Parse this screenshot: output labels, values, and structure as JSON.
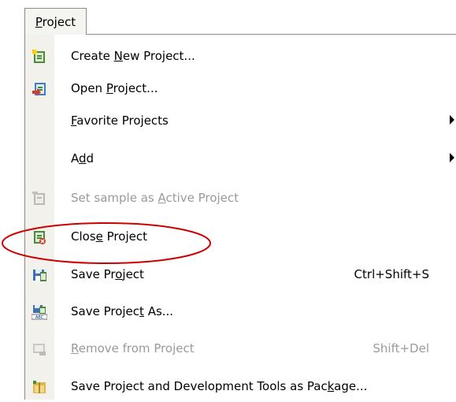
{
  "menu": {
    "title": "Project",
    "title_mnemonic_index": 0,
    "accent_color": "#cc0000",
    "items": [
      {
        "label_pre": "Create ",
        "label_mn": "N",
        "label_post": "ew Project...",
        "shortcut": "",
        "submenu": false,
        "disabled": false,
        "icon": "create-new-project-icon"
      },
      {
        "label_pre": "Open ",
        "label_mn": "P",
        "label_post": "roject...",
        "shortcut": "",
        "submenu": false,
        "disabled": false,
        "icon": "open-project-icon"
      },
      {
        "label_pre": "",
        "label_mn": "F",
        "label_post": "avorite Projects",
        "shortcut": "",
        "submenu": true,
        "disabled": false,
        "icon": ""
      },
      {
        "label_pre": "A",
        "label_mn": "d",
        "label_post": "d",
        "shortcut": "",
        "submenu": true,
        "disabled": false,
        "icon": ""
      },
      {
        "label_pre": "Set sample as ",
        "label_mn": "A",
        "label_post": "ctive Project",
        "shortcut": "",
        "submenu": false,
        "disabled": true,
        "icon": "set-active-project-icon"
      },
      {
        "label_pre": "Clos",
        "label_mn": "e",
        "label_post": " Project",
        "shortcut": "",
        "submenu": false,
        "disabled": false,
        "icon": "close-project-icon"
      },
      {
        "label_pre": "Save Pr",
        "label_mn": "o",
        "label_post": "ject",
        "shortcut": "Ctrl+Shift+S",
        "submenu": false,
        "disabled": false,
        "icon": "save-project-icon"
      },
      {
        "label_pre": "Save Projec",
        "label_mn": "t",
        "label_post": " As...",
        "shortcut": "",
        "submenu": false,
        "disabled": false,
        "icon": "save-project-as-icon"
      },
      {
        "label_pre": "",
        "label_mn": "R",
        "label_post": "emove from Project",
        "shortcut": "Shift+Del",
        "submenu": false,
        "disabled": true,
        "icon": "remove-from-project-icon"
      },
      {
        "label_pre": "Save Project and Development Tools as Pac",
        "label_mn": "k",
        "label_post": "age...",
        "shortcut": "",
        "submenu": false,
        "disabled": false,
        "icon": "package-icon"
      }
    ]
  }
}
